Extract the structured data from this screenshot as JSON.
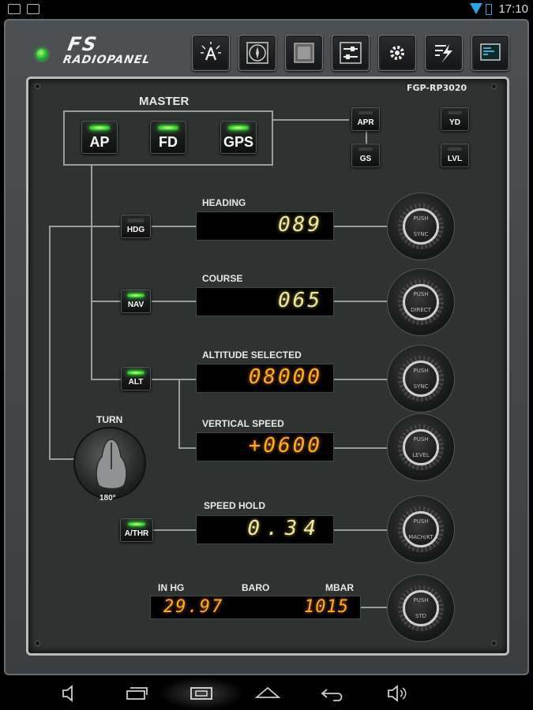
{
  "status_bar": {
    "time": "17:10"
  },
  "header": {
    "logo_line1": "FS",
    "logo_line2": "RADIOPANEL",
    "toolbar": [
      "autopilot-icon",
      "compass-icon",
      "display-icon",
      "sliders-icon",
      "settings-gear-icon",
      "lightning-icon",
      "monitor-icon"
    ]
  },
  "panel": {
    "model": "FGP-RP3020",
    "master": {
      "label": "MASTER",
      "ap": "AP",
      "fd": "FD",
      "gps": "GPS"
    },
    "mode_buttons": {
      "apr": "APR",
      "gs": "GS",
      "yd": "YD",
      "lvl": "LVL",
      "hdg": "HDG",
      "nav": "NAV",
      "alt": "ALT",
      "athr": "A/THR"
    },
    "heading": {
      "label": "HEADING",
      "value": "089"
    },
    "course": {
      "label": "COURSE",
      "value": "065"
    },
    "altitude": {
      "label": "ALTITUDE SELECTED",
      "value": "08000"
    },
    "vertical_speed": {
      "label": "VERTICAL SPEED",
      "value": "+0600"
    },
    "speed_hold": {
      "label": "SPEED HOLD",
      "value": "0.34"
    },
    "turn": {
      "label": "TURN",
      "value": "180°"
    },
    "baro": {
      "label": "BARO",
      "inhg_label": "IN HG",
      "mbar_label": "MBAR",
      "inhg_value": "29.97",
      "mbar_value": "1015"
    },
    "knob_text": {
      "heading": [
        "PUSH",
        "SYNC"
      ],
      "course": [
        "PUSH",
        "DIRECT"
      ],
      "altitude": [
        "PUSH",
        "SYNC"
      ],
      "vertical_speed": [
        "PUSH",
        "LEVEL"
      ],
      "speed_hold": [
        "PUSH",
        "MACH/KT"
      ],
      "baro": [
        "PUSH",
        "STD"
      ]
    }
  },
  "nav_bar": [
    "volume-down-icon",
    "back-layers-icon",
    "screenshot-icon",
    "home-icon",
    "back-icon",
    "volume-up-icon"
  ],
  "colors": {
    "led_green": "#37d12f",
    "seg_yellow": "#f0e8a0",
    "seg_orange": "#ffae1a"
  }
}
